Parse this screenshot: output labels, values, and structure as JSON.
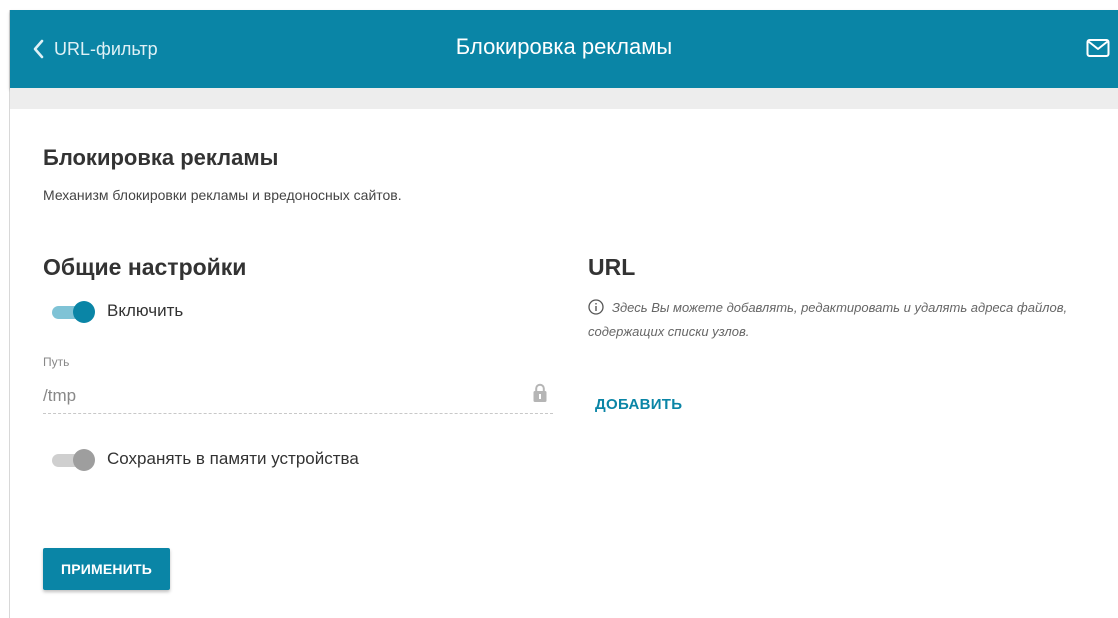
{
  "header": {
    "back_label": "URL-фильтр",
    "title": "Блокировка рекламы",
    "mail_icon": "envelope-icon"
  },
  "section": {
    "title": "Блокировка рекламы",
    "description": "Механизм блокировки рекламы и вредоносных сайтов."
  },
  "general": {
    "heading": "Общие настройки",
    "enable_label": "Включить",
    "enable_state": "on",
    "path_label": "Путь",
    "path_value": "/tmp",
    "save_label": "Сохранять в памяти устройства",
    "save_state": "off"
  },
  "url": {
    "heading": "URL",
    "info_text": "Здесь Вы можете добавлять, редактировать и удалять адреса файлов, содержащих списки узлов.",
    "add_label": "ДОБАВИТЬ"
  },
  "actions": {
    "apply_label": "ПРИМЕНИТЬ"
  },
  "colors": {
    "accent": "#0a85a6",
    "toggle_on_track": "#7fc3d6",
    "toggle_off_knob": "#9e9e9e"
  }
}
